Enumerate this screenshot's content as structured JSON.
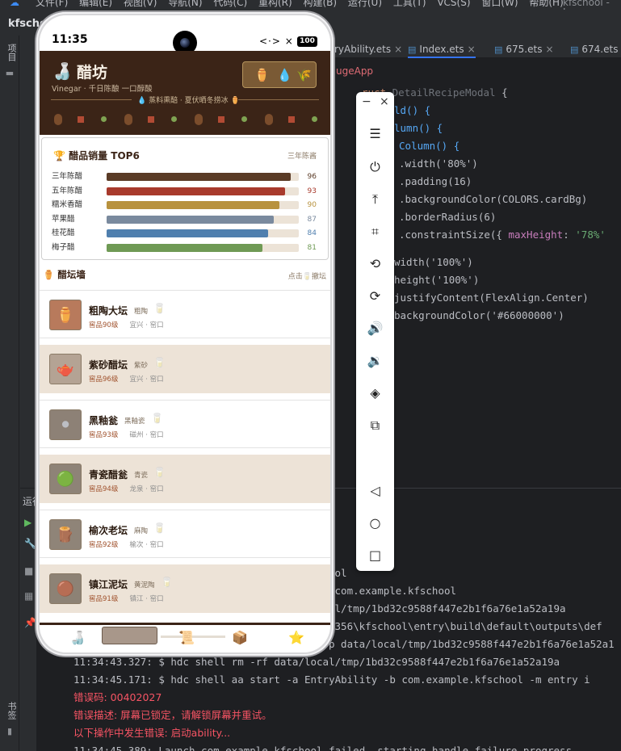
{
  "ide": {
    "menu": "文件(F)  编辑(E)  视图(V)  导航(N)  代码(C)  重构(R)  构建(B)  运行(U)  工具(T)  VCS(S)  窗口(W)  帮助(H)",
    "project_title": "kfschool - In",
    "project_label": "kfschoo",
    "side_project": "项目",
    "side_bookmark": "书签",
    "run_label": "运行",
    "tabs": [
      {
        "name": "ryAbility.ets",
        "active": false
      },
      {
        "name": "Index.ets",
        "active": true
      },
      {
        "name": "675.ets",
        "active": false
      },
      {
        "name": "674.ets",
        "active": false
      }
    ],
    "breadcrumb": "ugeApp",
    "code": {
      "l1_kw": "ruct",
      "l1_name": "DetailRecipeModal",
      "l1_brace": "{",
      "l2": "ld() {",
      "l3": "lumn() {",
      "l4": "Column() {",
      "l5": ".width('80%')",
      "l6": ".padding(16)",
      "l7": ".backgroundColor(COLORS.cardBg)",
      "l8": ".borderRadius(6)",
      "l9_a": ".constraintSize({ ",
      "l9_b": "maxHeight",
      "l9_c": ": ",
      "l9_d": "'78%'",
      "l10": "width('100%')",
      "l11": "height('100%')",
      "l12": "justifyContent(FlexAlign.Center)",
      "l13": "backgroundColor('#66000000')"
    },
    "console": [
      {
        "text": "ool",
        "type": "normal"
      },
      {
        "text": " com.example.kfschool",
        "type": "normal"
      },
      {
        "text": "al/tmp/1bd32c9588f447e2b1f6a76e1a52a19a",
        "type": "normal"
      },
      {
        "text": "6356\\kfschool\\entry\\build\\default\\outputs\\def",
        "type": "normal"
      },
      {
        "text": "p data/local/tmp/1bd32c9588f447e2b1f6a76e1a52a1",
        "type": "normal"
      },
      {
        "text": "11:34:43.327: $ hdc shell rm -rf data/local/tmp/1bd32c9588f447e2b1f6a76e1a52a19a",
        "type": "normal"
      },
      {
        "text": "11:34:45.171: $ hdc shell aa start -a EntryAbility -b com.example.kfschool -m entry i",
        "type": "normal"
      },
      {
        "text": "错误码: 00402027",
        "type": "error"
      },
      {
        "text": "错误描述: 屏幕已锁定，请解锁屏幕并重试。",
        "type": "error"
      },
      {
        "text": "以下操作中发生错误: 启动ability...",
        "type": "error"
      },
      {
        "text": "11:34:45.389: Launch com.example.kfschool failed, starting handle failure progress",
        "type": "normal"
      }
    ]
  },
  "phone": {
    "time": "11:35",
    "signal": "<·> ×",
    "battery": "100",
    "app": {
      "name": "醋坊",
      "subtitle": "Vinegar · 千日陈酿 一口醇酸",
      "tagline": "💧 蒸料熏醅 · 夏伏晒冬捞冰 ⚱️"
    },
    "chart_card": {
      "title": "🏆 醋品销量 TOP6",
      "note": "三年陈酱"
    },
    "chart_data": {
      "type": "bar",
      "categories": [
        "三年陈醋",
        "五年陈醋",
        "糯米香醋",
        "苹果醋",
        "桂花醋",
        "梅子醋"
      ],
      "values": [
        96,
        93,
        90,
        87,
        84,
        81
      ],
      "ylim": [
        0,
        100
      ],
      "colors": [
        "#5a3b26",
        "#a83a2c",
        "#b8923e",
        "#7a8a9e",
        "#4f7fae",
        "#6f9a55"
      ],
      "value_colors": [
        "#5a3b26",
        "#a83a2c",
        "#b8923e",
        "#7a8a9e",
        "#4f7fae",
        "#6f9a55"
      ]
    },
    "section": {
      "title": "⚱️ 醋坛墙",
      "note": "点击🥛撤坛"
    },
    "jars": [
      {
        "name": "粗陶大坛",
        "material": "粗陶",
        "grade": "窖品90级",
        "location": "宜兴 · 窑口",
        "thumb": "⚱️",
        "thumb_bg": "#b87a5c",
        "shade": false
      },
      {
        "name": "紫砂醋坛",
        "material": "紫砂",
        "grade": "窖品96级",
        "location": "宜兴 · 窑口",
        "thumb": "🫖",
        "thumb_bg": "#b4a394",
        "shade": true
      },
      {
        "name": "黑釉瓮",
        "material": "黑釉瓷",
        "grade": "窖品93级",
        "location": "磁州 · 窑口",
        "thumb": "⚫",
        "thumb_bg": "#8d8176",
        "shade": false
      },
      {
        "name": "青瓷醋瓮",
        "material": "青瓷",
        "grade": "窖品94级",
        "location": "龙泉 · 窑口",
        "thumb": "🟢",
        "thumb_bg": "#8e8377",
        "shade": true
      },
      {
        "name": "榆次老坛",
        "material": "麻陶",
        "grade": "窖品92级",
        "location": "榆次 · 窑口",
        "thumb": "🪵",
        "thumb_bg": "#8f8478",
        "shade": false
      },
      {
        "name": "镇江泥坛",
        "material": "黄泥陶",
        "grade": "窖品91级",
        "location": "镇江 · 窑口",
        "thumb": "🟤",
        "thumb_bg": "#8d8275",
        "shade": true
      }
    ],
    "nav": [
      "🍶",
      "",
      "📜",
      "📦",
      "⭐"
    ]
  },
  "emulator_toolbar": {
    "top_buttons": [
      "−",
      "×"
    ],
    "buttons": [
      "menu-icon",
      "power-icon",
      "upload-icon",
      "crop-icon",
      "rotate-left-icon",
      "rotate-right-icon",
      "volume-up-icon",
      "volume-down-icon",
      "shake-icon",
      "multi-screen-icon",
      "back-icon",
      "home-icon",
      "recent-icon"
    ]
  }
}
